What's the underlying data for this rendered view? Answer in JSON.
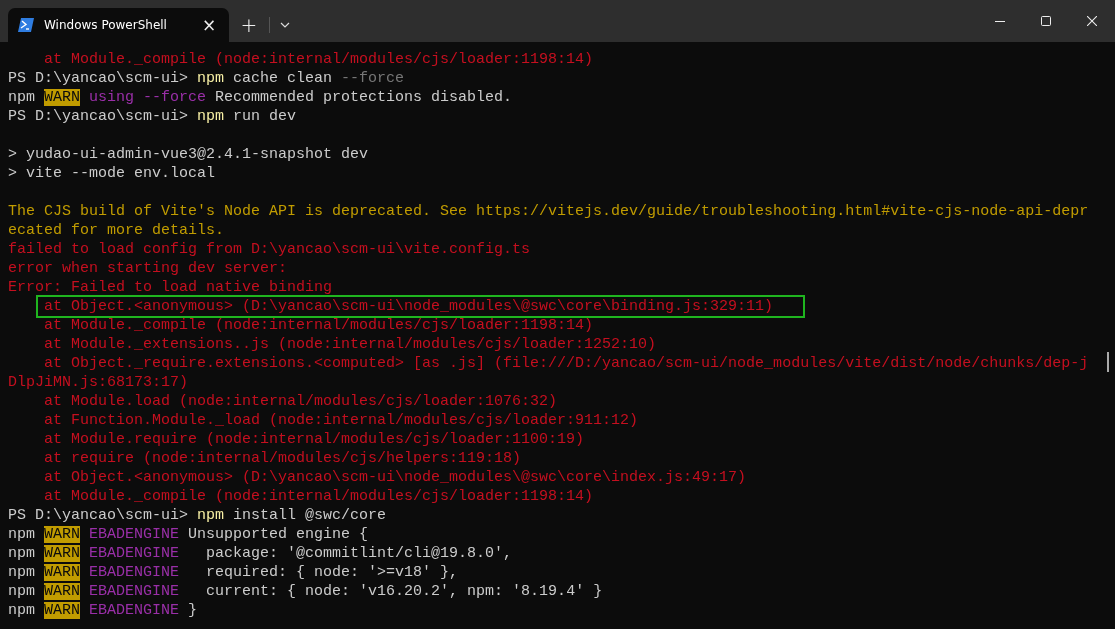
{
  "window": {
    "title": "Windows PowerShell",
    "tab_close": "×",
    "new_tab": "+"
  },
  "lines": [
    {
      "kind": "text",
      "highlighted": false,
      "segments": [
        {
          "kind": "error",
          "text": "    at Module._compile (node:internal/modules/cjs/loader:1198:14)"
        }
      ]
    },
    {
      "kind": "text",
      "highlighted": false,
      "segments": [
        {
          "kind": "plain",
          "text": "PS D:\\yancao\\scm-ui> "
        },
        {
          "kind": "command",
          "text": "npm"
        },
        {
          "kind": "plain",
          "text": " cache clean "
        },
        {
          "kind": "dim",
          "text": "--force"
        }
      ]
    },
    {
      "kind": "text",
      "highlighted": false,
      "segments": [
        {
          "kind": "plain",
          "text": "npm "
        },
        {
          "kind": "warn",
          "text": "WARN"
        },
        {
          "kind": "purple",
          "text": " using --force"
        },
        {
          "kind": "plain",
          "text": " Recommended protections disabled."
        }
      ]
    },
    {
      "kind": "text",
      "highlighted": false,
      "segments": [
        {
          "kind": "plain",
          "text": "PS D:\\yancao\\scm-ui> "
        },
        {
          "kind": "command",
          "text": "npm"
        },
        {
          "kind": "plain",
          "text": " run dev"
        }
      ]
    },
    {
      "kind": "blank"
    },
    {
      "kind": "text",
      "highlighted": false,
      "segments": [
        {
          "kind": "plain",
          "text": "> yudao-ui-admin-vue3@2.4.1-snapshot dev"
        }
      ]
    },
    {
      "kind": "text",
      "highlighted": false,
      "segments": [
        {
          "kind": "plain",
          "text": "> vite --mode env.local"
        }
      ]
    },
    {
      "kind": "blank"
    },
    {
      "kind": "text",
      "highlighted": false,
      "segments": [
        {
          "kind": "notice",
          "text": "The CJS build of Vite's Node API is deprecated. See https://vitejs.dev/guide/troubleshooting.html#vite-cjs-node-api-depr"
        }
      ]
    },
    {
      "kind": "text",
      "highlighted": false,
      "segments": [
        {
          "kind": "notice",
          "text": "ecated for more details."
        }
      ]
    },
    {
      "kind": "text",
      "highlighted": false,
      "segments": [
        {
          "kind": "error",
          "text": "failed to load config from D:\\yancao\\scm-ui\\vite.config.ts"
        }
      ]
    },
    {
      "kind": "text",
      "highlighted": false,
      "segments": [
        {
          "kind": "error",
          "text": "error when starting dev server:"
        }
      ]
    },
    {
      "kind": "text",
      "highlighted": false,
      "segments": [
        {
          "kind": "error",
          "text": "Error: Failed to load native binding"
        }
      ]
    },
    {
      "kind": "text",
      "highlighted": true,
      "segments": [
        {
          "kind": "error",
          "text": "    at Object.<anonymous> (D:\\yancao\\scm-ui\\node_modules\\@swc\\core\\binding.js:329:11)"
        }
      ]
    },
    {
      "kind": "text",
      "highlighted": false,
      "segments": [
        {
          "kind": "error",
          "text": "    at Module._compile (node:internal/modules/cjs/loader:1198:14)"
        }
      ]
    },
    {
      "kind": "text",
      "highlighted": false,
      "segments": [
        {
          "kind": "error",
          "text": "    at Module._extensions..js (node:internal/modules/cjs/loader:1252:10)"
        }
      ]
    },
    {
      "kind": "text",
      "highlighted": false,
      "segments": [
        {
          "kind": "error",
          "text": "    at Object._require.extensions.<computed> [as .js] (file:///D:/yancao/scm-ui/node_modules/vite/dist/node/chunks/dep-j"
        }
      ]
    },
    {
      "kind": "text",
      "highlighted": false,
      "segments": [
        {
          "kind": "error",
          "text": "DlpJiMN.js:68173:17)"
        }
      ]
    },
    {
      "kind": "text",
      "highlighted": false,
      "segments": [
        {
          "kind": "error",
          "text": "    at Module.load (node:internal/modules/cjs/loader:1076:32)"
        }
      ]
    },
    {
      "kind": "text",
      "highlighted": false,
      "segments": [
        {
          "kind": "error",
          "text": "    at Function.Module._load (node:internal/modules/cjs/loader:911:12)"
        }
      ]
    },
    {
      "kind": "text",
      "highlighted": false,
      "segments": [
        {
          "kind": "error",
          "text": "    at Module.require (node:internal/modules/cjs/loader:1100:19)"
        }
      ]
    },
    {
      "kind": "text",
      "highlighted": false,
      "segments": [
        {
          "kind": "error",
          "text": "    at require (node:internal/modules/cjs/helpers:119:18)"
        }
      ]
    },
    {
      "kind": "text",
      "highlighted": false,
      "segments": [
        {
          "kind": "error",
          "text": "    at Object.<anonymous> (D:\\yancao\\scm-ui\\node_modules\\@swc\\core\\index.js:49:17)"
        }
      ]
    },
    {
      "kind": "text",
      "highlighted": false,
      "segments": [
        {
          "kind": "error",
          "text": "    at Module._compile (node:internal/modules/cjs/loader:1198:14)"
        }
      ]
    },
    {
      "kind": "text",
      "highlighted": false,
      "segments": [
        {
          "kind": "plain",
          "text": "PS D:\\yancao\\scm-ui> "
        },
        {
          "kind": "command",
          "text": "npm"
        },
        {
          "kind": "plain",
          "text": " install @swc/core"
        }
      ]
    },
    {
      "kind": "text",
      "highlighted": false,
      "segments": [
        {
          "kind": "plain",
          "text": "npm "
        },
        {
          "kind": "warn",
          "text": "WARN"
        },
        {
          "kind": "purple",
          "text": " EBADENGINE"
        },
        {
          "kind": "plain",
          "text": " Unsupported engine {"
        }
      ]
    },
    {
      "kind": "text",
      "highlighted": false,
      "segments": [
        {
          "kind": "plain",
          "text": "npm "
        },
        {
          "kind": "warn",
          "text": "WARN"
        },
        {
          "kind": "purple",
          "text": " EBADENGINE"
        },
        {
          "kind": "plain",
          "text": "   package: '@commitlint/cli@19.8.0',"
        }
      ]
    },
    {
      "kind": "text",
      "highlighted": false,
      "segments": [
        {
          "kind": "plain",
          "text": "npm "
        },
        {
          "kind": "warn",
          "text": "WARN"
        },
        {
          "kind": "purple",
          "text": " EBADENGINE"
        },
        {
          "kind": "plain",
          "text": "   required: { node: '>=v18' },"
        }
      ]
    },
    {
      "kind": "text",
      "highlighted": false,
      "segments": [
        {
          "kind": "plain",
          "text": "npm "
        },
        {
          "kind": "warn",
          "text": "WARN"
        },
        {
          "kind": "purple",
          "text": " EBADENGINE"
        },
        {
          "kind": "plain",
          "text": "   current: { node: 'v16.20.2', npm: '8.19.4' }"
        }
      ]
    },
    {
      "kind": "text",
      "highlighted": false,
      "segments": [
        {
          "kind": "plain",
          "text": "npm "
        },
        {
          "kind": "warn",
          "text": "WARN"
        },
        {
          "kind": "purple",
          "text": " EBADENGINE"
        },
        {
          "kind": "plain",
          "text": " }"
        }
      ]
    }
  ]
}
